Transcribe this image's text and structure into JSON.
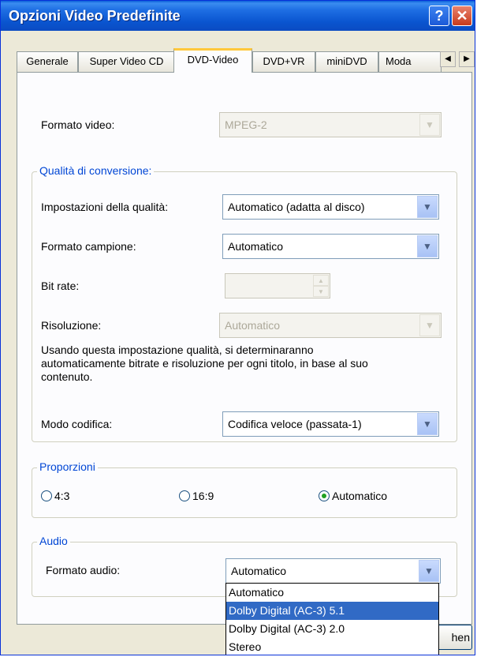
{
  "window": {
    "title": "Opzioni Video Predefinite",
    "help": "?",
    "close": "✕"
  },
  "tabs": [
    {
      "label": "Generale"
    },
    {
      "label": "Super Video CD"
    },
    {
      "label": "DVD-Video",
      "active": true
    },
    {
      "label": "DVD+VR"
    },
    {
      "label": "miniDVD"
    },
    {
      "label": "Moda"
    }
  ],
  "tab_scroll": {
    "left": "◀",
    "right": "▶"
  },
  "video": {
    "format_label": "Formato video:",
    "format_value": "MPEG-2"
  },
  "quality": {
    "group_title": "Qualità di conversione:",
    "settings_label": "Impostazioni della qualità:",
    "settings_value": "Automatico (adatta al disco)",
    "sample_label": "Formato campione:",
    "sample_value": "Automatico",
    "bitrate_label": "Bit rate:",
    "bitrate_value": "",
    "resolution_label": "Risoluzione:",
    "resolution_value": "Automatico",
    "note_line1": "Usando questa impostazione qualità, si determinaranno",
    "note_line2": "automaticamente bitrate e risoluzione per ogni titolo, in base al suo",
    "note_line3": "contenuto.",
    "encode_label": "Modo codifica:",
    "encode_value": "Codifica veloce (passata-1)"
  },
  "proportions": {
    "group_title": "Proporzioni",
    "options": [
      {
        "label": "4:3",
        "checked": false
      },
      {
        "label": "16:9",
        "checked": false
      },
      {
        "label": "Automatico",
        "checked": true
      }
    ]
  },
  "audio": {
    "group_title": "Audio",
    "format_label": "Formato audio:",
    "format_value": "Automatico",
    "dropdown_options": [
      {
        "label": "Automatico",
        "selected": false
      },
      {
        "label": "Dolby Digital (AC-3) 5.1",
        "selected": true
      },
      {
        "label": "Dolby Digital (AC-3) 2.0",
        "selected": false
      },
      {
        "label": "Stereo",
        "selected": false
      }
    ]
  },
  "buttons": {
    "partial_label": "hen"
  },
  "icons": {
    "dropdown_arrow": "chevron-down-icon",
    "spin": "spin-arrows-icon",
    "radio": "radio-icon"
  },
  "colors": {
    "title_blue": "#0a55d0",
    "group_title": "#0046d5",
    "selected": "#316ac5",
    "active_tab": "#ffc83c"
  }
}
